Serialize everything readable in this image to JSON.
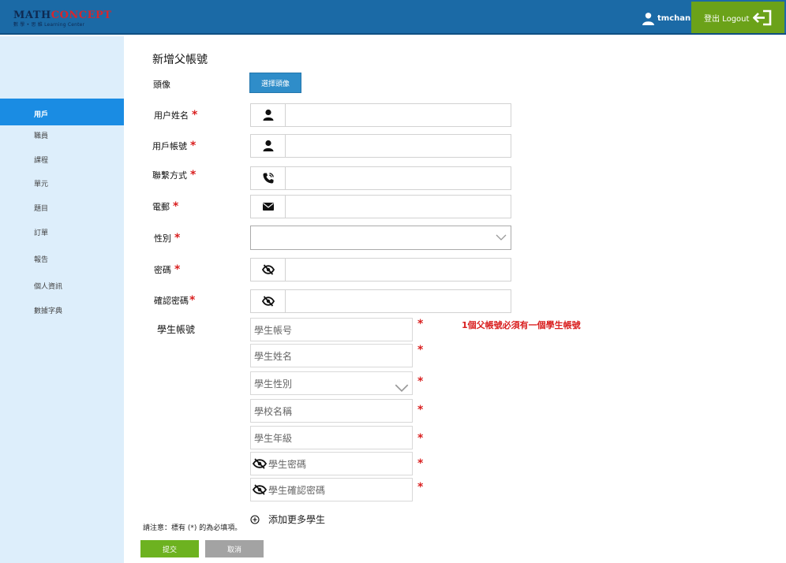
{
  "header": {
    "logo_part1": "MATH",
    "logo_part2": "CONCEPT",
    "logo_subtitle": "數 學 • 思 維  Learning Center",
    "username": "tmchan",
    "logout_label": "登出 Logout"
  },
  "sidebar": {
    "items": [
      {
        "label": "用戶",
        "active": true
      },
      {
        "label": "職員"
      },
      {
        "label": "課程"
      },
      {
        "label": "單元"
      },
      {
        "label": "題目"
      },
      {
        "label": "訂單"
      },
      {
        "label": "報告"
      },
      {
        "label": "個人資訊"
      },
      {
        "label": "數據字典"
      }
    ]
  },
  "form": {
    "title": "新增父帳號",
    "avatar_label": "頭像",
    "avatar_button": "選擇頭像",
    "fields": {
      "name": {
        "label": "用户姓名",
        "value": ""
      },
      "account": {
        "label": "用戶帳號",
        "value": ""
      },
      "contact": {
        "label": "聯繫方式",
        "value": ""
      },
      "email": {
        "label": "電郵",
        "value": ""
      },
      "gender": {
        "label": "性別",
        "value": ""
      },
      "password": {
        "label": "密碼",
        "value": ""
      },
      "confirm_password": {
        "label": "確認密碼",
        "value": ""
      }
    },
    "required_mark": "*",
    "student_section_label": "學生帳號",
    "student_note": "1個父帳號必須有一個學生帳號",
    "student_fields": {
      "account": {
        "placeholder": "學生帳号"
      },
      "name": {
        "placeholder": "學生姓名"
      },
      "gender": {
        "placeholder": "學生性別"
      },
      "school": {
        "placeholder": "學校名稱"
      },
      "grade": {
        "placeholder": "學生年級"
      },
      "password": {
        "placeholder": "學生密碼"
      },
      "confirm_password": {
        "placeholder": "學生確認密碼"
      }
    },
    "add_more_label": "添加更多學生",
    "footnote": "請注意：標有 (*) 的為必填項。",
    "submit_label": "提交",
    "cancel_label": "取消"
  },
  "colors": {
    "header": "#1b6aa6",
    "logout": "#6ba219",
    "sidebar": "#ddeefb",
    "sidebar_active": "#1a8ce3",
    "primary_button": "#2f8dc9",
    "required": "#d91f1f",
    "submit": "#6db220",
    "cancel": "#a3a3a3"
  },
  "icons": {
    "user": "user-icon",
    "phone": "phone-icon",
    "email": "envelope-icon",
    "password": "eye-slash-icon",
    "logout": "logout-icon",
    "add": "plus-circle-icon",
    "dropdown": "chevron-down-icon"
  }
}
